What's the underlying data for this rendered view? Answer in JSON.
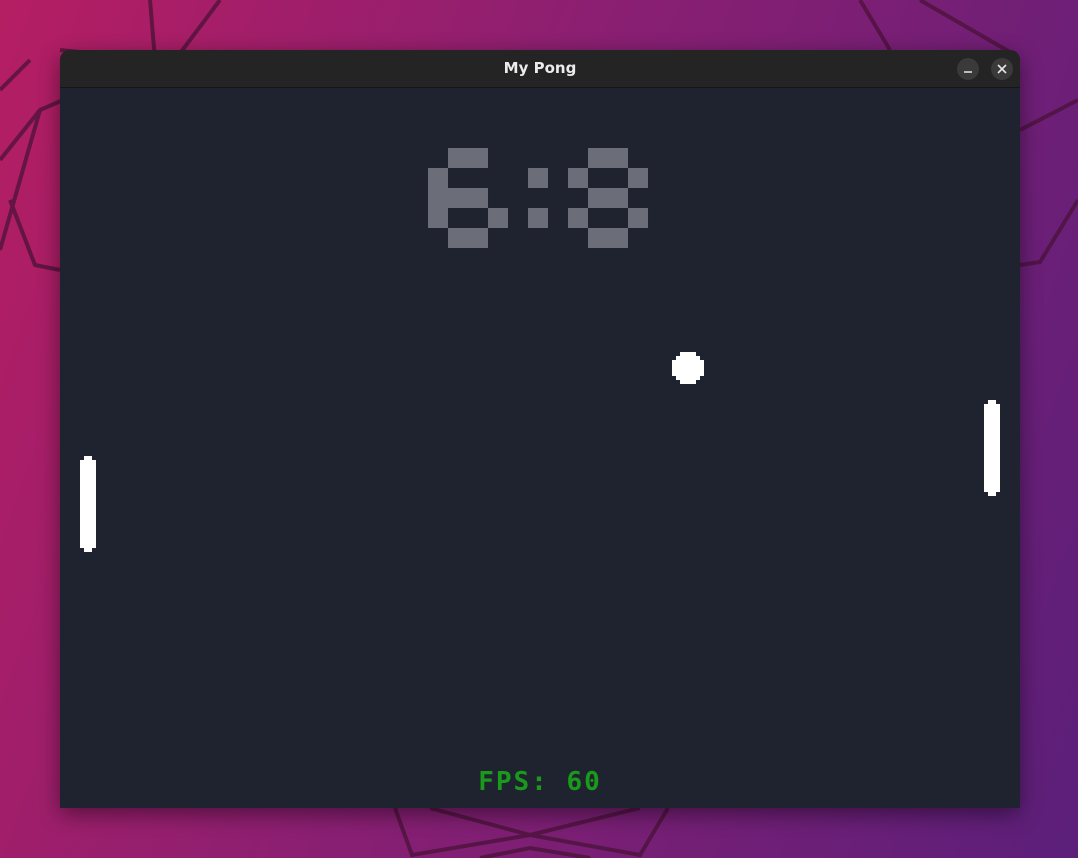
{
  "window": {
    "title": "My Pong"
  },
  "game": {
    "score": {
      "left": "6",
      "separator": ":",
      "right": "8"
    },
    "fps": {
      "label": "FPS:",
      "value": "60"
    },
    "colors": {
      "background": "#1f2330",
      "score": "#6b6d78",
      "fps": "#1a9a1a",
      "ball_and_paddles": "#ffffff"
    }
  },
  "controls": {
    "minimize_icon": "minimize-icon",
    "close_icon": "close-icon"
  }
}
